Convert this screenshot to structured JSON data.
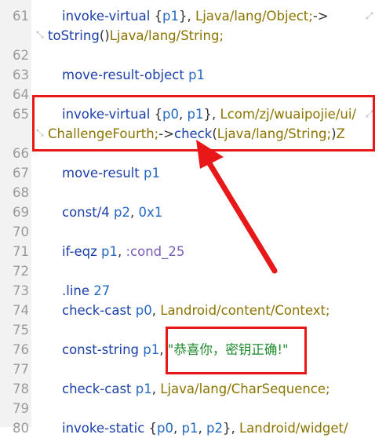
{
  "editor": {
    "lines": [
      {
        "n": "61",
        "parts": [
          [
            "op",
            "invoke-virtual "
          ],
          [
            "p",
            "{"
          ],
          [
            "reg",
            "p1"
          ],
          [
            "p",
            "}, "
          ],
          [
            "type",
            "Ljava/lang/Object;"
          ],
          [
            "p",
            "->"
          ]
        ],
        "cont": [
          [
            "op",
            "toString"
          ],
          [
            "p",
            "()"
          ],
          [
            "type",
            "Ljava/lang/String;"
          ]
        ]
      },
      {
        "n": "62",
        "parts": []
      },
      {
        "n": "63",
        "parts": [
          [
            "op",
            "move-result-object "
          ],
          [
            "reg",
            "p1"
          ]
        ]
      },
      {
        "n": "64",
        "parts": []
      },
      {
        "n": "65",
        "parts": [
          [
            "op",
            "invoke-virtual "
          ],
          [
            "p",
            "{"
          ],
          [
            "reg",
            "p0"
          ],
          [
            "p",
            ", "
          ],
          [
            "reg",
            "p1"
          ],
          [
            "p",
            "}, "
          ],
          [
            "type",
            "Lcom/zj/wuaipojie/ui/"
          ]
        ],
        "cont": [
          [
            "type",
            "ChallengeFourth;"
          ],
          [
            "p",
            "->"
          ],
          [
            "op",
            "check"
          ],
          [
            "p",
            "("
          ],
          [
            "type",
            "Ljava/lang/String;"
          ],
          [
            "p",
            ")"
          ],
          [
            "type",
            "Z"
          ]
        ]
      },
      {
        "n": "66",
        "parts": []
      },
      {
        "n": "67",
        "parts": [
          [
            "op",
            "move-result "
          ],
          [
            "reg",
            "p1"
          ]
        ]
      },
      {
        "n": "68",
        "parts": []
      },
      {
        "n": "69",
        "parts": [
          [
            "op",
            "const/4 "
          ],
          [
            "reg",
            "p2"
          ],
          [
            "p",
            ", "
          ],
          [
            "num",
            "0x1"
          ]
        ]
      },
      {
        "n": "70",
        "parts": []
      },
      {
        "n": "71",
        "parts": [
          [
            "op",
            "if-eqz "
          ],
          [
            "reg",
            "p1"
          ],
          [
            "p",
            ", "
          ],
          [
            "label",
            ":cond_25"
          ]
        ]
      },
      {
        "n": "72",
        "parts": []
      },
      {
        "n": "73",
        "parts": [
          [
            "dir",
            ".line "
          ],
          [
            "num",
            "27"
          ]
        ]
      },
      {
        "n": "74",
        "parts": [
          [
            "op",
            "check-cast "
          ],
          [
            "reg",
            "p0"
          ],
          [
            "p",
            ", "
          ],
          [
            "type",
            "Landroid/content/Context;"
          ]
        ]
      },
      {
        "n": "75",
        "parts": []
      },
      {
        "n": "76",
        "parts": [
          [
            "op",
            "const-string "
          ],
          [
            "reg",
            "p1"
          ],
          [
            "p",
            ", "
          ],
          [
            "str",
            "\"恭喜你，密钥正确!\""
          ]
        ]
      },
      {
        "n": "77",
        "parts": []
      },
      {
        "n": "78",
        "parts": [
          [
            "op",
            "check-cast "
          ],
          [
            "reg",
            "p1"
          ],
          [
            "p",
            ", "
          ],
          [
            "type",
            "Ljava/lang/CharSequence;"
          ]
        ]
      },
      {
        "n": "79",
        "parts": []
      },
      {
        "n": "80",
        "parts": [
          [
            "op",
            "invoke-static "
          ],
          [
            "p",
            "{"
          ],
          [
            "reg",
            "p0"
          ],
          [
            "p",
            ", "
          ],
          [
            "reg",
            "p1"
          ],
          [
            "p",
            ", "
          ],
          [
            "reg",
            "p2"
          ],
          [
            "p",
            "}, "
          ],
          [
            "type",
            "Landroid/widget/"
          ]
        ]
      }
    ]
  },
  "colors": {
    "highlight": "#e81818",
    "opcode": "#1a3fa8",
    "register": "#2469c2",
    "type": "#8b7400",
    "string": "#1e8a2e",
    "gutter": "#f2f2f2"
  },
  "icons": {
    "wrap_start": "wrap-arrow-icon",
    "wrap_end": "wrap-arrow-icon"
  }
}
